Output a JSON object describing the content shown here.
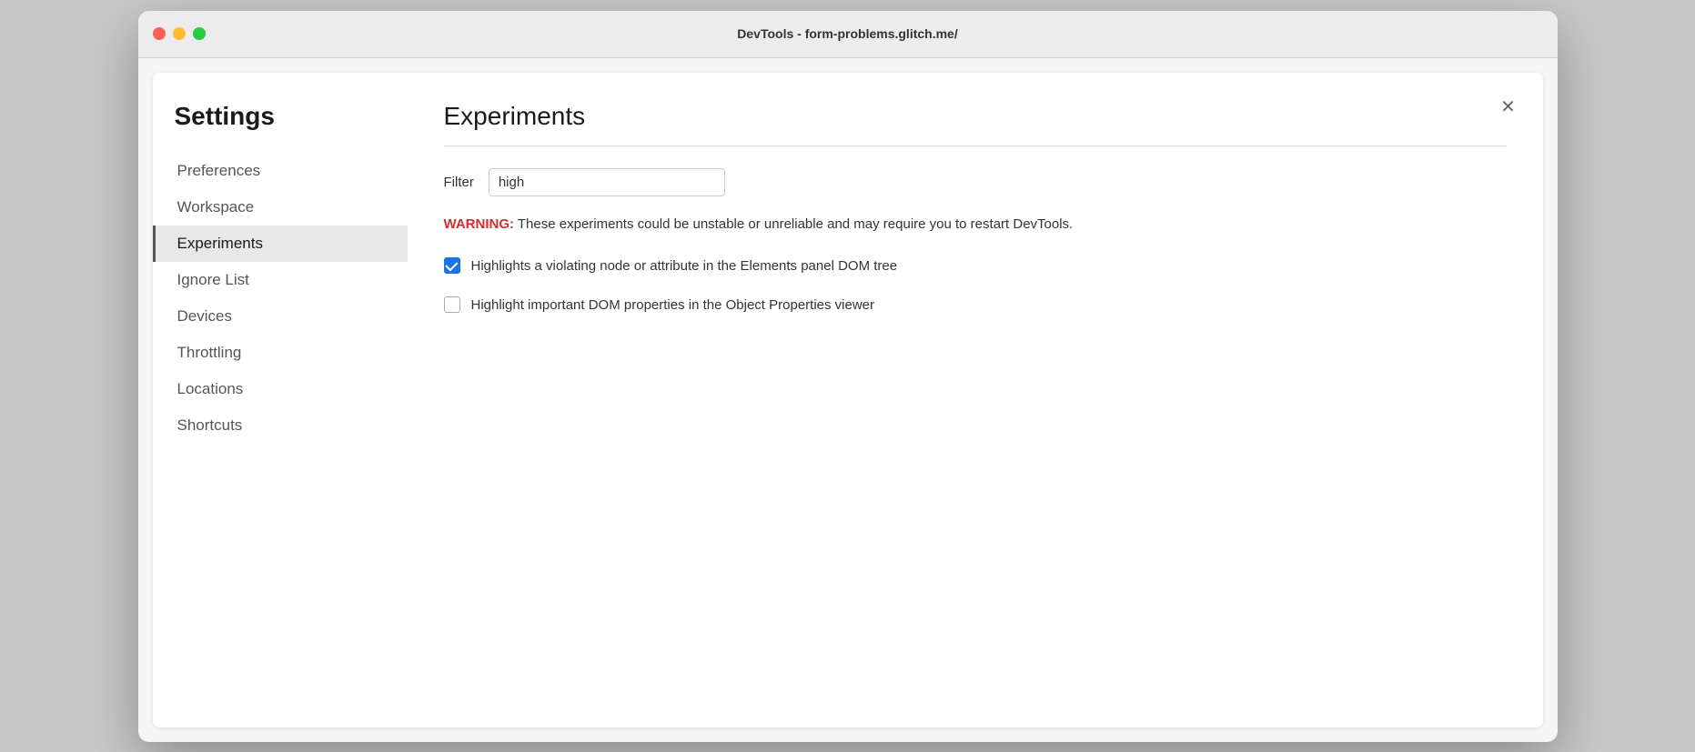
{
  "window": {
    "title": "DevTools - form-problems.glitch.me/"
  },
  "sidebar": {
    "heading": "Settings",
    "items": [
      {
        "id": "preferences",
        "label": "Preferences",
        "active": false
      },
      {
        "id": "workspace",
        "label": "Workspace",
        "active": false
      },
      {
        "id": "experiments",
        "label": "Experiments",
        "active": true
      },
      {
        "id": "ignore-list",
        "label": "Ignore List",
        "active": false
      },
      {
        "id": "devices",
        "label": "Devices",
        "active": false
      },
      {
        "id": "throttling",
        "label": "Throttling",
        "active": false
      },
      {
        "id": "locations",
        "label": "Locations",
        "active": false
      },
      {
        "id": "shortcuts",
        "label": "Shortcuts",
        "active": false
      }
    ]
  },
  "main": {
    "title": "Experiments",
    "close_label": "×",
    "filter": {
      "label": "Filter",
      "value": "high",
      "placeholder": ""
    },
    "warning": {
      "prefix": "WARNING:",
      "text": " These experiments could be unstable or unreliable and may require you to restart DevTools."
    },
    "experiments": [
      {
        "id": "exp1",
        "label": "Highlights a violating node or attribute in the Elements panel DOM tree",
        "checked": true
      },
      {
        "id": "exp2",
        "label": "Highlight important DOM properties in the Object Properties viewer",
        "checked": false
      }
    ]
  },
  "icons": {
    "close": "✕"
  }
}
